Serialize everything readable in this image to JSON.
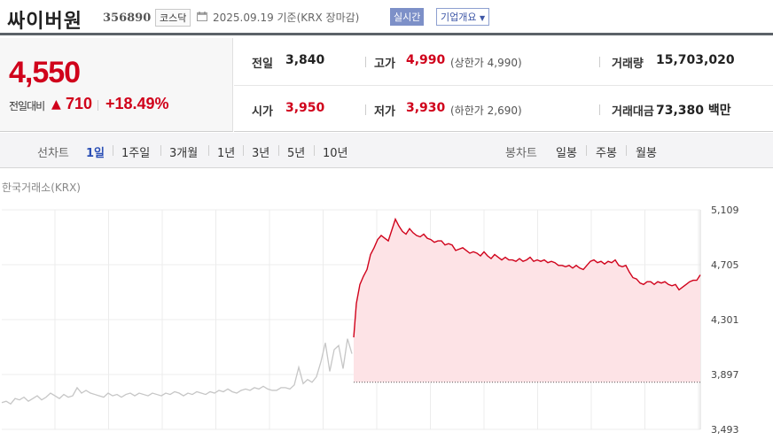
{
  "header": {
    "name": "싸이버원",
    "code": "356890",
    "market": "코스닥",
    "date": "2025.09.19  기준(KRX 장마감)",
    "realtime_label": "실시간",
    "corp_label": "기업개요"
  },
  "price": {
    "current": "4,550",
    "change_label": "전일대비",
    "change": "710",
    "change_pct": "+18.49%"
  },
  "stats": {
    "prev_label": "전일",
    "prev": "3,840",
    "high_label": "고가",
    "high": "4,990",
    "upper_limit": "(상한가 4,990)",
    "volume_label": "거래량",
    "volume": "15,703,020",
    "open_label": "시가",
    "open": "3,950",
    "low_label": "저가",
    "low": "3,930",
    "lower_limit": "(하한가 2,690)",
    "amount_label": "거래대금",
    "amount": "73,380 백만"
  },
  "period_bar": {
    "line_label": "선차트",
    "line_items": [
      "1일",
      "1주일",
      "3개월",
      "1년",
      "3년",
      "5년",
      "10년"
    ],
    "selected": "1일",
    "candle_label": "봉차트",
    "candle_items": [
      "일봉",
      "주봉",
      "월봉"
    ]
  },
  "chart_source": "한국거래소(KRX)",
  "colors": {
    "up": "#d0021b",
    "accent": "#2b4fb5",
    "fill": "#fde3e6"
  },
  "chart_data": {
    "type": "line",
    "ylim": [
      3493,
      5109
    ],
    "yticks": [
      5109,
      4705,
      4301,
      3897,
      3493
    ],
    "ytick_labels": [
      "5,109",
      "4,705",
      "4,301",
      "3,897",
      "3,493"
    ],
    "baseline": 3840,
    "x": [
      0,
      5,
      10,
      15,
      20,
      25,
      30,
      35,
      40,
      45,
      50,
      55,
      60,
      65,
      70,
      75,
      80,
      85,
      90,
      95,
      100,
      105,
      110,
      115,
      120,
      125,
      130,
      135,
      140,
      145,
      150,
      155,
      160,
      165,
      170,
      175,
      180,
      185,
      190,
      195,
      200,
      205,
      210,
      215,
      220,
      225,
      230,
      235,
      240,
      245,
      250,
      255,
      260,
      265,
      270,
      275,
      280,
      285,
      290,
      295,
      300,
      305,
      310,
      315,
      320,
      325,
      330,
      335,
      340,
      345,
      350,
      355,
      360,
      365,
      370,
      375,
      380,
      385,
      390,
      395,
      400,
      405,
      410,
      415,
      420,
      425,
      430,
      435,
      440,
      445,
      450,
      455,
      460,
      465,
      470,
      475,
      480,
      485,
      490,
      495,
      500,
      505,
      510,
      515,
      520,
      525,
      530,
      535,
      540,
      545,
      550,
      555,
      560,
      565,
      570,
      575,
      580,
      585,
      590,
      595,
      600,
      605,
      610,
      615,
      620,
      625,
      630,
      635,
      640,
      645,
      650,
      655,
      660,
      665,
      670,
      675,
      680,
      685,
      690,
      695,
      700,
      705,
      710,
      715,
      720,
      725,
      730,
      735,
      740,
      745,
      750,
      755,
      760,
      765,
      770,
      775,
      780,
      785
    ],
    "series": [
      {
        "values": [
          3690,
          3700,
          3680,
          3720,
          3710,
          3730,
          3700,
          3720,
          3740,
          3710,
          3730,
          3760,
          3740,
          3720,
          3750,
          3730,
          3740,
          3800,
          3760,
          3780,
          3760,
          3750,
          3740,
          3730,
          3760,
          3740,
          3750,
          3730,
          3750,
          3760,
          3740,
          3760,
          3750,
          3740,
          3760,
          3750,
          3740,
          3760,
          3750,
          3770,
          3760,
          3740,
          3760,
          3750,
          3770,
          3760,
          3750,
          3770,
          3760,
          3780,
          3770,
          3790,
          3770,
          3760,
          3780,
          3790,
          3780,
          3800,
          3790,
          3810,
          3790,
          3780,
          3780,
          3800,
          3800,
          3790,
          3820,
          3950,
          3830,
          3860,
          3840,
          3880,
          3990,
          4130,
          3920,
          4080,
          4110,
          3940,
          4160,
          4050,
          3900,
          3880,
          3890,
          3880,
          3880,
          3880,
          3880,
          3880,
          3880,
          3880,
          3880,
          3880,
          3880,
          3880,
          3880,
          3880,
          3880,
          3880,
          3880,
          3880,
          3880,
          3880,
          3880,
          3880,
          3880,
          3880,
          3880,
          3880,
          3880,
          3880,
          3880,
          3880,
          3880,
          3880,
          3880,
          3880,
          3880,
          3880,
          3880,
          3880,
          3880,
          3880,
          3880,
          3880,
          3880,
          3880,
          3880,
          3880,
          3880,
          3880,
          3880,
          3880,
          3880,
          3880,
          3880,
          3880,
          3880,
          3880,
          3880,
          3880,
          3880,
          3880,
          3880,
          3880,
          3880,
          3880,
          3880,
          3880
        ],
        "day": [
          [
            397,
            4170
          ],
          [
            400,
            4420
          ],
          [
            404,
            4560
          ],
          [
            408,
            4620
          ],
          [
            412,
            4670
          ],
          [
            416,
            4780
          ],
          [
            420,
            4830
          ],
          [
            424,
            4890
          ],
          [
            428,
            4920
          ],
          [
            432,
            4900
          ],
          [
            436,
            4880
          ],
          [
            440,
            4960
          ],
          [
            444,
            5040
          ],
          [
            448,
            4990
          ],
          [
            452,
            4950
          ],
          [
            456,
            4930
          ],
          [
            460,
            4970
          ],
          [
            464,
            4940
          ],
          [
            468,
            4920
          ],
          [
            472,
            4910
          ],
          [
            476,
            4930
          ],
          [
            480,
            4900
          ],
          [
            484,
            4890
          ],
          [
            488,
            4870
          ],
          [
            492,
            4880
          ],
          [
            496,
            4880
          ],
          [
            500,
            4850
          ],
          [
            504,
            4860
          ],
          [
            508,
            4850
          ],
          [
            512,
            4810
          ],
          [
            516,
            4820
          ],
          [
            520,
            4830
          ],
          [
            524,
            4810
          ],
          [
            528,
            4790
          ],
          [
            532,
            4800
          ],
          [
            536,
            4790
          ],
          [
            540,
            4770
          ],
          [
            544,
            4800
          ],
          [
            548,
            4770
          ],
          [
            552,
            4750
          ],
          [
            556,
            4780
          ],
          [
            560,
            4760
          ],
          [
            564,
            4740
          ],
          [
            568,
            4760
          ],
          [
            572,
            4740
          ],
          [
            576,
            4740
          ],
          [
            580,
            4730
          ],
          [
            584,
            4750
          ],
          [
            588,
            4730
          ],
          [
            592,
            4740
          ],
          [
            596,
            4760
          ],
          [
            600,
            4730
          ],
          [
            604,
            4740
          ],
          [
            608,
            4730
          ],
          [
            612,
            4740
          ],
          [
            616,
            4720
          ],
          [
            620,
            4730
          ],
          [
            624,
            4720
          ],
          [
            628,
            4700
          ],
          [
            632,
            4700
          ],
          [
            636,
            4690
          ],
          [
            640,
            4700
          ],
          [
            644,
            4680
          ],
          [
            648,
            4700
          ],
          [
            652,
            4680
          ],
          [
            656,
            4670
          ],
          [
            660,
            4700
          ],
          [
            664,
            4730
          ],
          [
            668,
            4740
          ],
          [
            672,
            4720
          ],
          [
            676,
            4730
          ],
          [
            680,
            4710
          ],
          [
            684,
            4730
          ],
          [
            688,
            4720
          ],
          [
            692,
            4740
          ],
          [
            696,
            4700
          ],
          [
            700,
            4690
          ],
          [
            704,
            4700
          ],
          [
            708,
            4650
          ],
          [
            712,
            4610
          ],
          [
            716,
            4600
          ],
          [
            720,
            4570
          ],
          [
            724,
            4560
          ],
          [
            728,
            4580
          ],
          [
            732,
            4580
          ],
          [
            736,
            4560
          ],
          [
            740,
            4580
          ],
          [
            744,
            4570
          ],
          [
            748,
            4580
          ],
          [
            752,
            4560
          ],
          [
            756,
            4550
          ],
          [
            760,
            4560
          ],
          [
            764,
            4520
          ],
          [
            768,
            4540
          ],
          [
            772,
            4560
          ],
          [
            776,
            4580
          ],
          [
            780,
            4590
          ],
          [
            784,
            4590
          ],
          [
            788,
            4630
          ]
        ]
      }
    ]
  }
}
